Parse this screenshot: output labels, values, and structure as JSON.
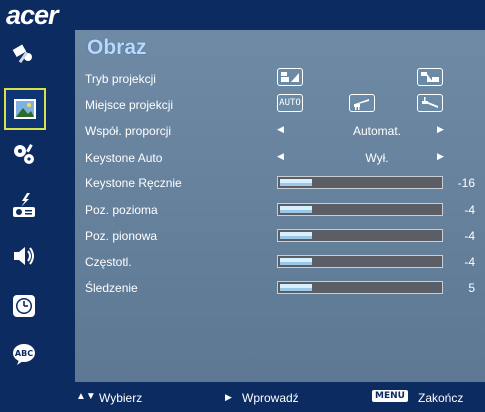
{
  "brand": "acer",
  "title": "Obraz",
  "sidebar": {
    "items": [
      {
        "icon": "color-management-icon",
        "active": false
      },
      {
        "icon": "image-icon",
        "active": true
      },
      {
        "icon": "settings-gears-icon",
        "active": false
      },
      {
        "icon": "projector-management-icon",
        "active": false
      },
      {
        "icon": "audio-speaker-icon",
        "active": false
      },
      {
        "icon": "timer-clock-icon",
        "active": false
      },
      {
        "icon": "language-abc-icon",
        "active": false
      }
    ]
  },
  "rows": {
    "projection_mode": {
      "label": "Tryb projekcji"
    },
    "projection_location": {
      "label": "Miejsce projekcji",
      "auto_label": "AUTO"
    },
    "aspect_ratio": {
      "label": "Współ. proporcji",
      "value": "Automat."
    },
    "keystone_auto": {
      "label": "Keystone Auto",
      "value": "Wył."
    },
    "keystone_manual": {
      "label": "Keystone Ręcznie",
      "value": "-16",
      "level": 0.2
    },
    "h_position": {
      "label": "Poz. pozioma",
      "value": "-4",
      "level": 0.2
    },
    "v_position": {
      "label": "Poz. pionowa",
      "value": "-4",
      "level": 0.2
    },
    "frequency": {
      "label": "Częstotl.",
      "value": "-4",
      "level": 0.2
    },
    "tracking": {
      "label": "Śledzenie",
      "value": "5",
      "level": 0.2
    }
  },
  "footer": {
    "select": "Wybierz",
    "enter": "Wprowadź",
    "menu_key": "MENU",
    "exit": "Zakończ"
  }
}
